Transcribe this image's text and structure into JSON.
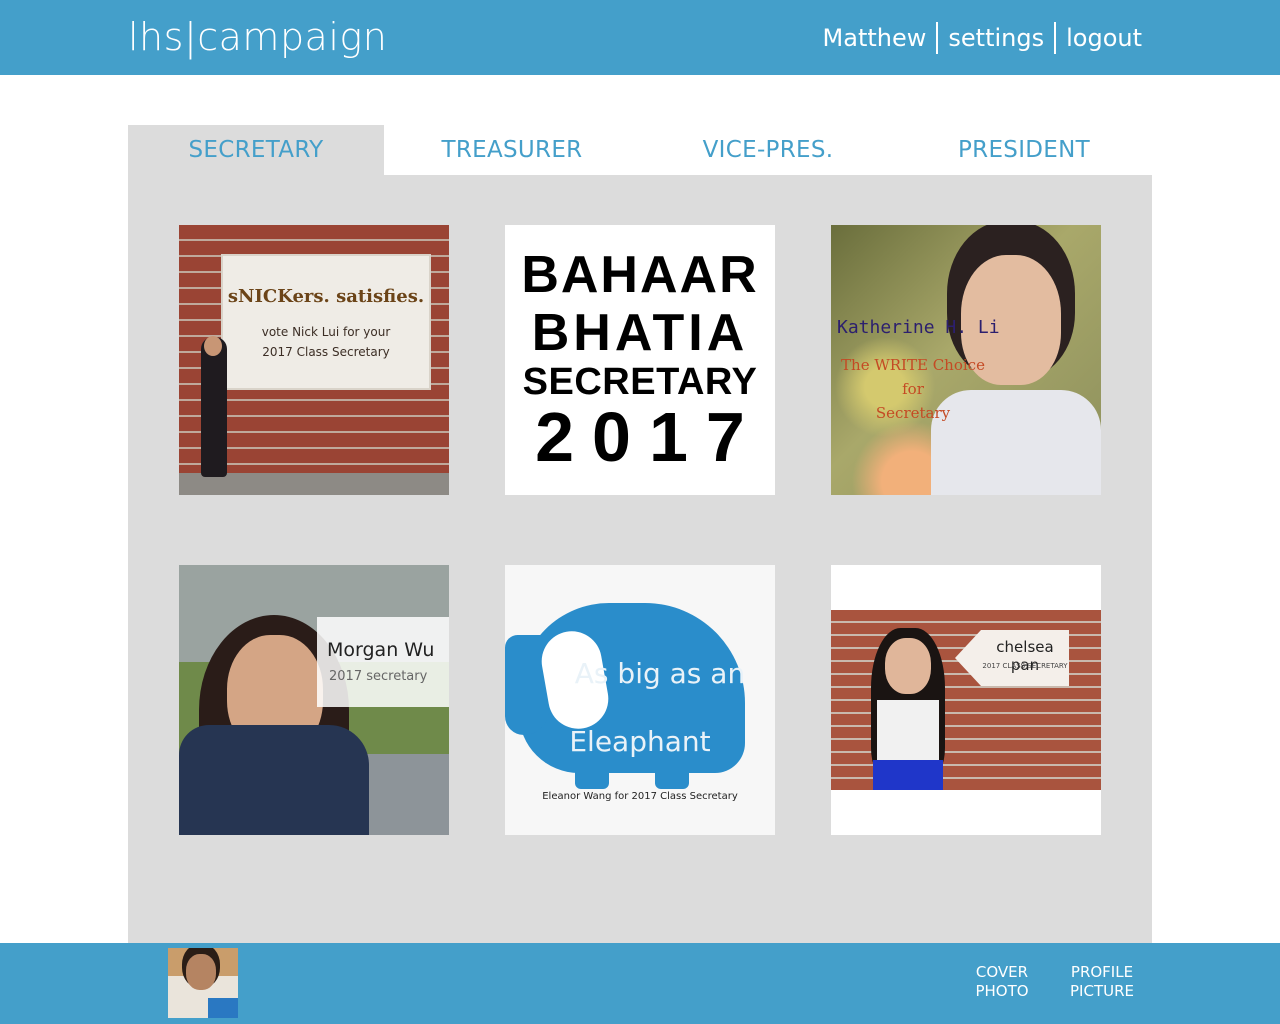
{
  "header": {
    "brand": "lhs|campaign",
    "nav": [
      "Matthew",
      "settings",
      "logout"
    ]
  },
  "tabs": [
    {
      "label": "SECRETARY",
      "active": true
    },
    {
      "label": "TREASURER",
      "active": false
    },
    {
      "label": "VICE-PRES.",
      "active": false
    },
    {
      "label": "PRESIDENT",
      "active": false
    }
  ],
  "posters": {
    "nick": {
      "line1": "sNICKers. satisfies.",
      "line2": "vote Nick Lui for your",
      "line3": "2017 Class Secretary"
    },
    "bahaar": {
      "line1": "BAHAAR",
      "line2": "BHATIA",
      "line3": "SECRETARY",
      "line4": "2017"
    },
    "katherine": {
      "name": "Katherine H. Li",
      "line2": "The WRITE Choice for",
      "line3": "Secretary"
    },
    "morgan": {
      "name": "Morgan Wu",
      "line2": "2017 secretary"
    },
    "eleanor": {
      "line1": "As big as an",
      "line2": "Eleaphant",
      "line3": "Eleanor Wang for 2017 Class Secretary"
    },
    "chelsea": {
      "name": "chelsea pan",
      "line2": "2017 CLASS SECRETARY"
    }
  },
  "footer": {
    "cover_photo": "COVER PHOTO",
    "cover_line1": "COVER",
    "cover_line2": "PHOTO",
    "profile_line1": "PROFILE",
    "profile_line2": "PICTURE"
  },
  "colors": {
    "accent": "#449fca",
    "panel": "#dcdcdc"
  }
}
